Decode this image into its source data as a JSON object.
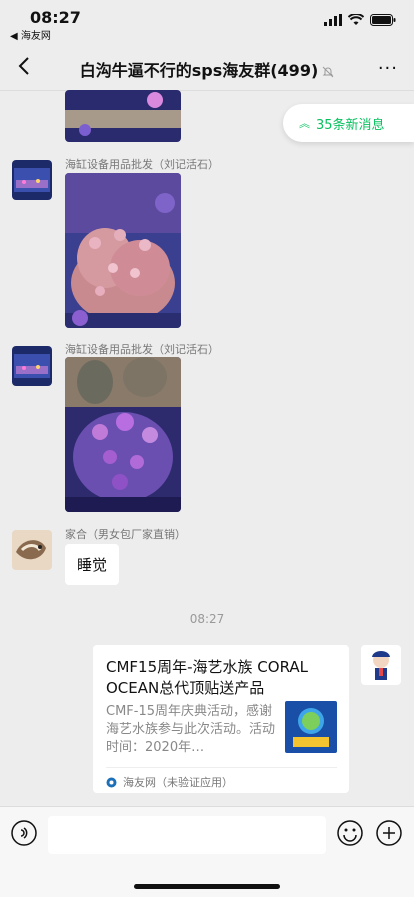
{
  "status": {
    "time": "08:27",
    "back_app": "◀ 海友网"
  },
  "nav": {
    "title": "白沟牛逼不行的sps海友群(499)",
    "more": "···"
  },
  "new_messages": {
    "label": "35条新消息"
  },
  "messages": [
    {
      "sender": "海缸设备用品批发（刘记活石）"
    },
    {
      "sender": "海缸设备用品批发（刘记活石）"
    },
    {
      "sender": "家合（男女包厂家直销）",
      "text": "睡觉"
    }
  ],
  "timestamp": "08:27",
  "card": {
    "title": "CMF15周年-海艺水族 CORAL OCEAN总代顶贴送产品",
    "description": "CMF-15周年庆典活动，感谢海艺水族参与此次活动。活动时间：2020年…",
    "source": "海友网（未验证应用）"
  },
  "colors": {
    "accent": "#07c160",
    "background": "#ededed"
  }
}
